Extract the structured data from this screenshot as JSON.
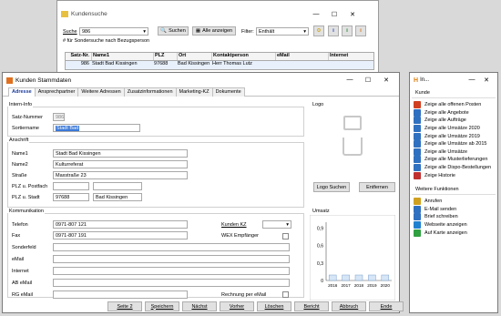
{
  "search": {
    "title": "Kundensuche",
    "suche_label": "Suche",
    "suche_value": "986",
    "search_btn": "Suchen",
    "all_btn": "Alle anzeigen",
    "filter_label": "Filter:",
    "filter_value": "Enthält",
    "hint": "# für Sondersuche nach Bezugsperson",
    "columns": [
      "Satz-Nr.",
      "Name1",
      "PLZ",
      "Ort",
      "Kontaktperson",
      "eMail",
      "Internet"
    ],
    "row": [
      "986",
      "Stadt Bad Kissingen",
      "97688",
      "Bad Kissingen",
      "Herr Thomas Lutz",
      "",
      ""
    ]
  },
  "main": {
    "title": "Kunden Stammdaten",
    "tabs": [
      "Adresse",
      "Ansprechpartner",
      "Weitere Adressen",
      "Zusatzinformationen",
      "Marketing-KZ",
      "Dokumente"
    ],
    "intern_title": "Intern-Info",
    "satznummer_label": "Satz-Nummer",
    "satznummer_value": "986",
    "sortiername_label": "Sortiername",
    "sortiername_value": "Stadt Bad",
    "logo_title": "Logo",
    "logo_search_btn": "Logo Suchen",
    "logo_remove_btn": "Entfernen",
    "anschrift_title": "Anschrift",
    "name1_label": "Name1",
    "name1_value": "Stadt Bad Kissingen",
    "name2_label": "Name2",
    "name2_value": "Kulturreferat",
    "strasse_label": "Straße",
    "strasse_value": "Maxstraße 23",
    "plz_postfach_label": "PLZ u. Postfach",
    "plz_stadt_label": "PLZ u. Stadt",
    "plz_value": "97688",
    "stadt_value": "Bad Kissingen",
    "komm_title": "Kommunikation",
    "telefon_label": "Telefon",
    "telefon_value": "0971-807 121",
    "fax_label": "Fax",
    "fax_value": "0971-807 191",
    "sonderfeld_label": "Sonderfeld",
    "email_label": "eMail",
    "internet_label": "Internet",
    "ab_email_label": "AB eMail",
    "rg_email_label": "RG eMail",
    "kunden_kz_label": "Kunden KZ",
    "wex_label": "WEX Empfänger",
    "rechnung_label": "Rechnung per eMail",
    "umsatz_title": "Umsatz",
    "footer_buttons": [
      "Seite 2",
      "Speichern",
      "Nächst",
      "Vorher",
      "Löschen",
      "Bericht",
      "Abbruch",
      "Ende"
    ]
  },
  "chart_data": {
    "type": "bar",
    "categories": [
      "2016",
      "2017",
      "2018",
      "2019",
      "2020"
    ],
    "values": [
      0,
      0,
      0,
      0,
      0
    ],
    "title": "",
    "xlabel": "",
    "ylabel": "",
    "yticks": [
      "0,9",
      "0,6",
      "0,3",
      "0"
    ],
    "ylim": [
      0,
      1
    ]
  },
  "side": {
    "title": "In...",
    "kunde_header": "Kunde",
    "items": [
      "Zeige alle offenen Posten",
      "Zeige alle Angebote",
      "Zeige alle Aufträge",
      "Zeige alle Umsätze 2020",
      "Zeige alle Umsätze 2019",
      "Zeige alle Umsätze ab 2015",
      "Zeige alle Umsätze",
      "Zeige alle Musterlieferungen",
      "Zeige alle Dispo-Bestellungen",
      "Zeige Historie"
    ],
    "item_colors": [
      "#d04020",
      "#3070c0",
      "#3070c0",
      "#3070c0",
      "#3070c0",
      "#3070c0",
      "#3070c0",
      "#3070c0",
      "#3070c0",
      "#c03030"
    ],
    "weitere_header": "Weitere Funktionen",
    "functions": [
      "Anrufen",
      "E-Mail senden",
      "Brief schreiben",
      "Webseite anzeigen",
      "Auf Karte anzeigen"
    ],
    "function_colors": [
      "#d0a020",
      "#3070c0",
      "#3070c0",
      "#2080d0",
      "#30a040"
    ]
  }
}
